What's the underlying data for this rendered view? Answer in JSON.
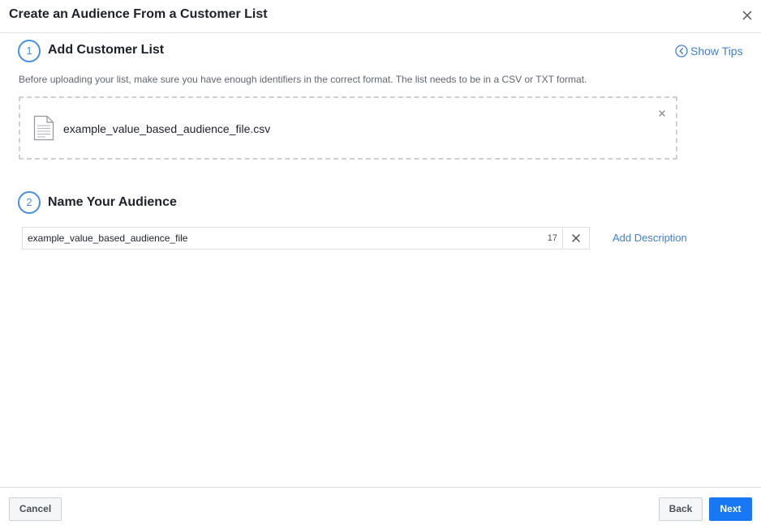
{
  "dialog": {
    "title": "Create an Audience From a Customer List"
  },
  "step1": {
    "number": "1",
    "title": "Add Customer List",
    "description": "Before uploading your list, make sure you have enough identifiers in the correct format. The list needs to be in a CSV or TXT format.",
    "file_name": "example_value_based_audience_file.csv"
  },
  "show_tips_label": "Show Tips",
  "step2": {
    "number": "2",
    "title": "Name Your Audience",
    "audience_name": "example_value_based_audience_file",
    "char_count": "17",
    "add_description_label": "Add Description"
  },
  "footer": {
    "cancel_label": "Cancel",
    "back_label": "Back",
    "next_label": "Next"
  },
  "colors": {
    "accent": "#1877f2",
    "link": "#4080d0",
    "step_circle": "#4a90e2"
  }
}
